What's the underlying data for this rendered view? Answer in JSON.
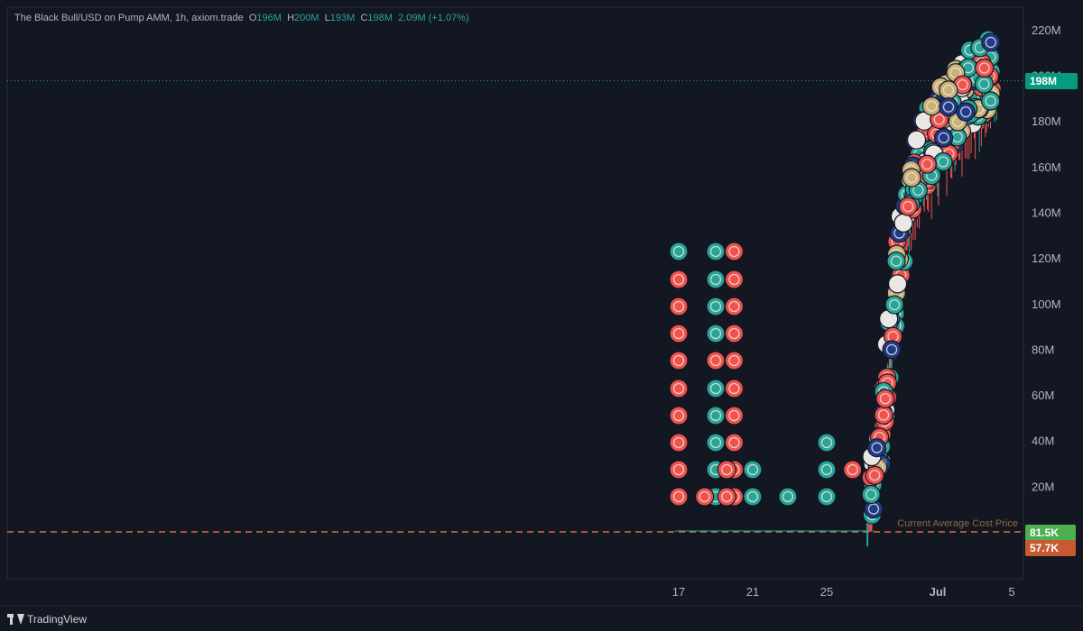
{
  "legend": {
    "symbol": "The Black Bull/USD on Pump AMM, 1h, axiom.trade",
    "o_label": "O",
    "o_value": "196M",
    "h_label": "H",
    "h_value": "200M",
    "l_label": "L",
    "l_value": "193M",
    "c_label": "C",
    "c_value": "198M",
    "change": "2.09M (+1.07%)"
  },
  "footer": {
    "brand": "TradingView"
  },
  "price_tags": {
    "last": "198M",
    "current_avg": "81.5K",
    "avg_cost": "57.7K"
  },
  "annotation": {
    "avg_line_label": "Current Average Cost Price"
  },
  "colors": {
    "background": "#131722",
    "up": "#26a69a",
    "down": "#ef5350",
    "last_tag": "#089981",
    "avg_tag": "#4caf50",
    "cost_tag": "#c85a32",
    "cost_line": "#e07040"
  },
  "chart_data": {
    "type": "candlestick",
    "y_ticks": [
      "20M",
      "40M",
      "60M",
      "80M",
      "100M",
      "120M",
      "140M",
      "160M",
      "180M",
      "200M",
      "220M"
    ],
    "y_tick_values": [
      20,
      40,
      60,
      80,
      100,
      120,
      140,
      160,
      180,
      200,
      220
    ],
    "ylim": [
      0,
      225
    ],
    "x_ticks": [
      "17",
      "21",
      "25",
      "Jul",
      "5"
    ],
    "last_price": 198,
    "series": [
      {
        "name": "close",
        "points": [
          {
            "t": "Jun 26",
            "v": 0.1
          },
          {
            "t": "Jun 27",
            "v": 0.3
          },
          {
            "t": "Jun 28 00:00",
            "v": 6
          },
          {
            "t": "Jun 28 12:00",
            "v": 40
          },
          {
            "t": "Jun 29",
            "v": 85
          },
          {
            "t": "Jun 30",
            "v": 130
          },
          {
            "t": "Jul 1",
            "v": 160
          },
          {
            "t": "Jul 2",
            "v": 175
          },
          {
            "t": "Jul 3",
            "v": 190
          },
          {
            "t": "Jul 4",
            "v": 198
          }
        ]
      }
    ],
    "trade_markers": [
      {
        "day": "17",
        "kind": "mixed",
        "count": 12
      },
      {
        "day": "19",
        "kind": "buy",
        "count": 12
      },
      {
        "day": "20",
        "kind": "sell",
        "count": 12
      },
      {
        "day": "21",
        "kind": "buy",
        "count": 2
      },
      {
        "day": "23",
        "kind": "buy",
        "count": 1
      },
      {
        "day": "25",
        "kind": "buy",
        "count": 3
      },
      {
        "day": "27-Jul 4",
        "kind": "cluster",
        "count": 220
      }
    ]
  }
}
